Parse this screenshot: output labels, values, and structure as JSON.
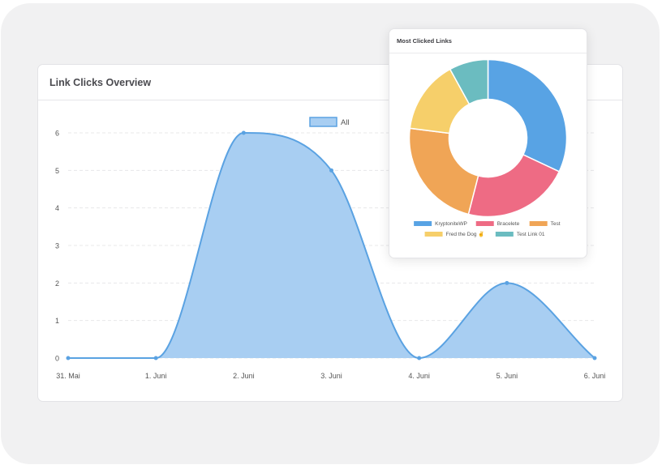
{
  "line_card": {
    "title": "Link Clicks Overview"
  },
  "pie_card": {
    "title": "Most Clicked Links"
  },
  "colors": {
    "line_stroke": "#5aa2e2",
    "line_fill": "#a8cef2",
    "pie": [
      "#58a3e4",
      "#ee6b84",
      "#f0a556",
      "#f6cf6a",
      "#6bbcc0"
    ]
  },
  "chart_data": [
    {
      "type": "area",
      "title": "Link Clicks Overview",
      "categories": [
        "31. Mai",
        "1. Juni",
        "2. Juni",
        "3. Juni",
        "4. Juni",
        "5. Juni",
        "6. Juni"
      ],
      "series": [
        {
          "name": "All",
          "values": [
            0,
            0,
            6,
            5,
            0,
            2,
            0
          ]
        }
      ],
      "ylim": [
        0,
        6
      ],
      "yticks": [
        0,
        1,
        2,
        3,
        4,
        5,
        6
      ],
      "grid": true,
      "legend": "top"
    },
    {
      "type": "pie",
      "title": "Most Clicked Links",
      "labels": [
        "KryptoniteWP",
        "Bracelete",
        "Test",
        "Fred the Dog ✌️",
        "Test Link 01"
      ],
      "values": [
        32,
        22,
        23,
        15,
        8
      ],
      "donut": true,
      "legend": "bottom"
    }
  ]
}
